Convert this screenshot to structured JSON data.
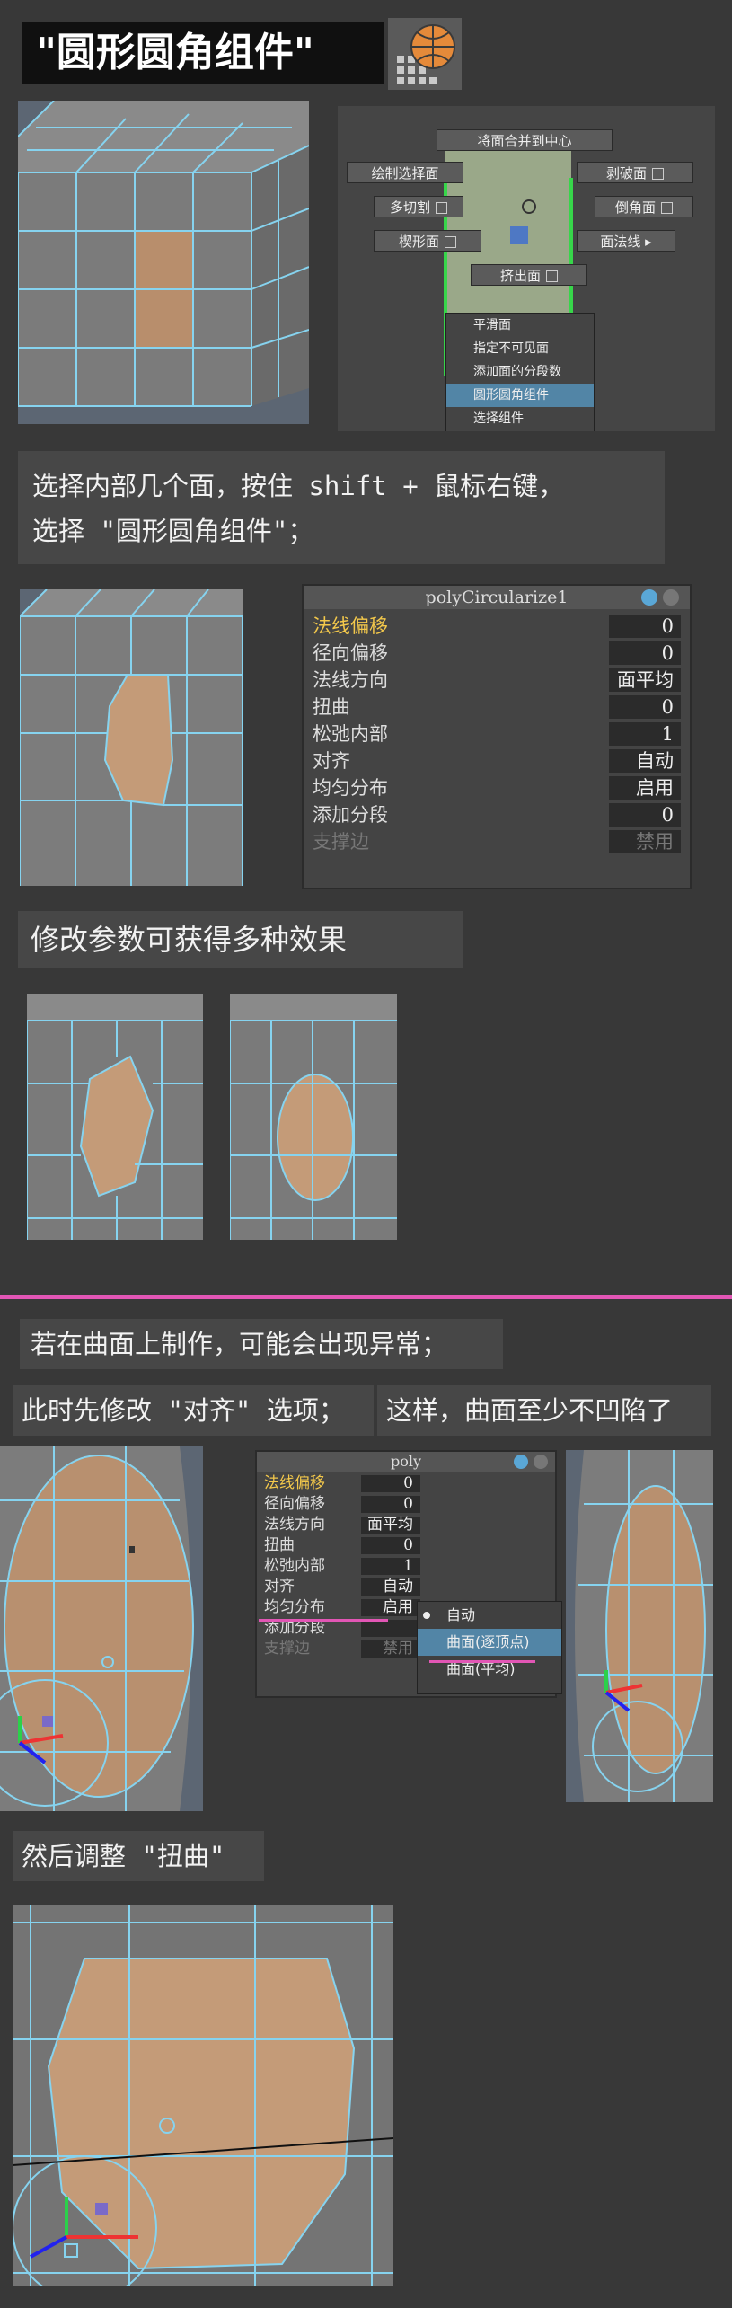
{
  "title": "\"圆形圆角组件\"",
  "icon_name": "circularize-icon",
  "menu": {
    "merge_to_center": "将面合并到中心",
    "draw_select_face": "绘制选择面",
    "peel_face": "剥破面",
    "multi_cut": "多切割",
    "bevel_face": "倒角面",
    "wedge_face": "楔形面",
    "face_normal": "面法线",
    "extrude_face": "挤出面",
    "submenu": [
      "平滑面",
      "指定不可见面",
      "添加面的分段数",
      "圆形圆角组件",
      "选择组件"
    ]
  },
  "caption1": {
    "line1": "选择内部几个面，按住 shift + 鼠标右键，",
    "line2": "选择 \"圆形圆角组件\"；"
  },
  "panel": {
    "title": "polyCircularize1",
    "rows": [
      {
        "label": "法线偏移",
        "value": "0"
      },
      {
        "label": "径向偏移",
        "value": "0"
      },
      {
        "label": "法线方向",
        "value": "面平均"
      },
      {
        "label": "扭曲",
        "value": "0"
      },
      {
        "label": "松弛内部",
        "value": "1"
      },
      {
        "label": "对齐",
        "value": "自动"
      },
      {
        "label": "均匀分布",
        "value": "启用"
      },
      {
        "label": "添加分段",
        "value": "0"
      },
      {
        "label": "支撑边",
        "value": "禁用"
      }
    ]
  },
  "caption2": "修改参数可获得多种效果",
  "caption3": "若在曲面上制作，可能会出现异常；",
  "caption4": "此时先修改 \"对齐\" 选项；",
  "caption5": "这样，曲面至少不凹陷了",
  "panel_small": {
    "title": "poly",
    "rows": [
      {
        "label": "法线偏移",
        "value": "0"
      },
      {
        "label": "径向偏移",
        "value": "0"
      },
      {
        "label": "法线方向",
        "value": "面平均"
      },
      {
        "label": "扭曲",
        "value": "0"
      },
      {
        "label": "松弛内部",
        "value": "1"
      },
      {
        "label": "对齐",
        "value": "自动"
      },
      {
        "label": "均匀分布",
        "value": "启用"
      },
      {
        "label": "添加分段",
        "value": ""
      },
      {
        "label": "支撑边",
        "value": "禁用"
      }
    ],
    "dropdown": [
      "自动",
      "曲面(逐顶点)",
      "曲面(平均)"
    ]
  },
  "caption6": "然后调整 \"扭曲\"",
  "colors": {
    "accent_pink": "#e256b5",
    "highlight_yellow": "#f3c84b",
    "face_orange": "#c89a72",
    "wire_cyan": "#7fd3f0"
  }
}
